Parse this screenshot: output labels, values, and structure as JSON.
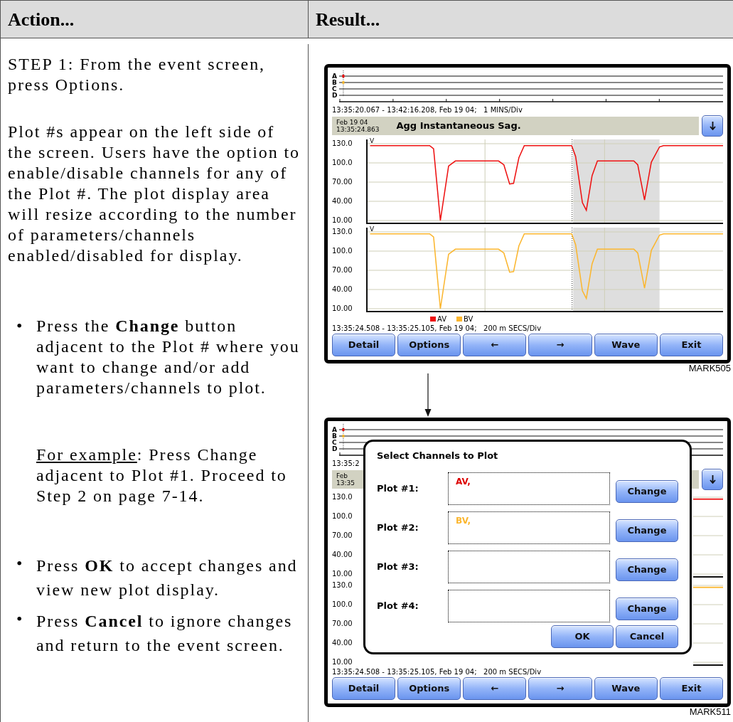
{
  "table": {
    "columns": [
      "Action...",
      "Result..."
    ]
  },
  "steps": [
    {
      "kind": "paragraph",
      "text": "STEP 1: From the event screen, press Options."
    },
    {
      "kind": "paragraph",
      "text": "Plot #s appear on the left side of the screen. Users have the option to enable/disable channels for any of the Plot #. The plot display area will resize according to the number of parameters/channels enabled/disabled for display."
    },
    {
      "kind": "bullet",
      "marker": "•",
      "text": "Press the **Change** button adjacent to the Plot # where you want to change and/or add parameters/channels to plot."
    },
    {
      "kind": "example",
      "underlined": "For example",
      "text": ": Press Change adjacent to Plot #1. Proceed to Step 2 on page 7-14."
    },
    {
      "kind": "bullet",
      "marker": "•",
      "text": "Press **OK** to accept changes and view new plot display."
    },
    {
      "kind": "bullet",
      "marker": "•",
      "text": "Press **Cancel** to ignore changes and return to the event screen."
    }
  ],
  "screens": [
    {
      "strip_labels": [
        "A",
        "B",
        "C",
        "D"
      ],
      "range_text": "13:35:20.067 - 13:42:16.208, Feb 19 04;   1 MINS/Div",
      "event_date": "Feb 19 04",
      "event_time": "13:35:24.863",
      "event_title": "Agg Instantaneous Sag.",
      "plots": [
        {
          "unit": "V",
          "color": "#ee1111",
          "ticks": [
            "130.0",
            "100.0",
            "70.00",
            "40.00",
            "10.00"
          ]
        },
        {
          "unit": "V",
          "color": "#fbb62e",
          "ticks": [
            "130.0",
            "100.0",
            "70.00",
            "40.00",
            "10.00"
          ]
        }
      ],
      "legend": [
        {
          "label": "AV",
          "color": "#ee1111"
        },
        {
          "label": "BV",
          "color": "#fbb62e"
        }
      ],
      "bottom_range": "13:35:24.508 - 13:35:25.105, Feb 19 04;   200 m SECS/Div",
      "buttons": [
        "Detail",
        "Options",
        "←",
        "→",
        "Wave",
        "Exit"
      ],
      "caption": "MARK505"
    },
    {
      "strip_labels": [
        "A",
        "B",
        "C",
        "D"
      ],
      "range_text": "13:35:2",
      "event_date": "Feb",
      "event_time": "13:35",
      "plots": [
        {
          "color": "#ee1111",
          "ticks": [
            "130.0",
            "100.0",
            "70.00",
            "40.00",
            "10.00"
          ]
        },
        {
          "color": "#fbb62e",
          "ticks": [
            "130.0",
            "100.0",
            "70.00",
            "40.00",
            "10.00"
          ]
        }
      ],
      "dialog": {
        "title": "Select Channels to Plot",
        "rows": [
          {
            "label": "Plot #1:",
            "channels": [
              {
                "text": "AV,",
                "color": "#dd0000"
              }
            ],
            "button": "Change"
          },
          {
            "label": "Plot #2:",
            "channels": [
              {
                "text": "BV,",
                "color": "#fbb62e"
              }
            ],
            "button": "Change"
          },
          {
            "label": "Plot #3:",
            "button": "Change"
          },
          {
            "label": "Plot #4:",
            "button": "Change"
          }
        ],
        "actions": [
          "OK",
          "Cancel"
        ]
      },
      "bottom_range": "13:35:24.508 - 13:35:25.105, Feb 19 04;   200 m SECS/Div",
      "buttons": [
        "Detail",
        "Options",
        "←",
        "→",
        "Wave",
        "Exit"
      ],
      "caption": "MARK511"
    }
  ]
}
